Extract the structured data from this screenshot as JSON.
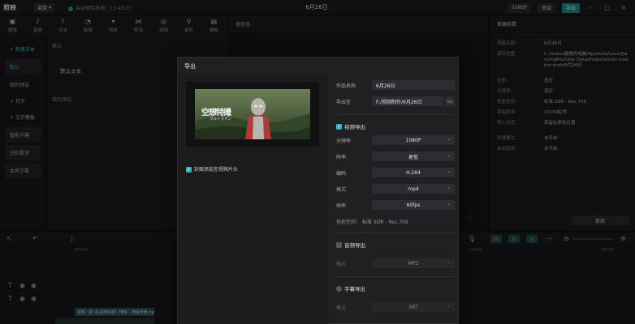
{
  "titlebar": {
    "logo": "剪映",
    "menu": "菜单",
    "autosave": "自动保存本地：12:43:07",
    "title": "6月26日",
    "mode_chip": "1080P",
    "review": "审阅",
    "export": "导出"
  },
  "tabs": [
    {
      "label": "媒体",
      "icon": "media-icon"
    },
    {
      "label": "音频",
      "icon": "audio-icon"
    },
    {
      "label": "文本",
      "icon": "text-icon",
      "active": true
    },
    {
      "label": "贴纸",
      "icon": "sticker-icon"
    },
    {
      "label": "特效",
      "icon": "effects-icon"
    },
    {
      "label": "转场",
      "icon": "transition-icon"
    },
    {
      "label": "滤镜",
      "icon": "filter-icon"
    },
    {
      "label": "调节",
      "icon": "adjust-icon"
    },
    {
      "label": "模板",
      "icon": "template-icon"
    }
  ],
  "sidebar": {
    "items": [
      {
        "label": "+ 新建文本",
        "active": true,
        "sub": false
      },
      {
        "label": "默认",
        "active": true,
        "sub": true
      },
      {
        "label": "我的预设",
        "active": false,
        "sub": false
      },
      {
        "label": "+ 花字",
        "active": false,
        "sub": false
      },
      {
        "label": "+ 文字模板",
        "active": false,
        "sub": false
      },
      {
        "label": "智能字幕",
        "active": false,
        "sub": true
      },
      {
        "label": "识别歌词",
        "active": false,
        "sub": true
      },
      {
        "label": "本地字幕",
        "active": false,
        "sub": true
      }
    ]
  },
  "content": {
    "section1": "默认",
    "default_text": "默认文本",
    "section2": "我的预设"
  },
  "player": {
    "title": "播放器"
  },
  "right_panel": {
    "title": "草稿参数",
    "rows": [
      {
        "key": "草稿名称：",
        "value": "6月26日"
      },
      {
        "key": "保存位置：",
        "value": "C:/Users/晨旗的电脑/AppData/Local/JianyingPro/User Data/Projects/com.lveditor.draft/6月26日"
      },
      {
        "key": "比例：",
        "value": "适应"
      },
      {
        "key": "分辨率：",
        "value": "适应"
      },
      {
        "key": "色彩空间：",
        "value": "标准 SDR - Rec.709"
      },
      {
        "key": "草稿帧率：",
        "value": "30.00帧/秒"
      },
      {
        "key": "导入方式：",
        "value": "保留在原有位置"
      },
      {
        "key": "代理模式：",
        "value": "未开启"
      },
      {
        "key": "自由层级：",
        "value": "未开启"
      }
    ],
    "edit": "修改"
  },
  "timeline": {
    "ruler": [
      "|00:00",
      "|00:30",
      "|00:00"
    ],
    "clip_label": "视频《初 高清奥特曼》特辑 - 神秘怪兽.mp4"
  },
  "modal": {
    "title": "导出",
    "thumb_title": "空想特撮",
    "thumb_sub": "ウルトラマン",
    "cover_check": "封面添加至视频片头",
    "name_label": "作品名称",
    "name_value": "6月26日",
    "path_label": "导出至",
    "path_value": "F:/视频制作/6月26日",
    "video_section": "视频导出",
    "video_fields": [
      {
        "label": "分辨率",
        "value": "1080P"
      },
      {
        "label": "码率",
        "value": "更低"
      },
      {
        "label": "编码",
        "value": "H.264"
      },
      {
        "label": "格式",
        "value": "mp4"
      },
      {
        "label": "帧率",
        "value": "60fps"
      }
    ],
    "color_space": "色彩空间：  标准 SDR - Rec.709",
    "audio_section": "音频导出",
    "audio_format_label": "格式",
    "audio_format_value": "MP3",
    "subtitle_section": "字幕导出",
    "subtitle_format_label": "格式",
    "subtitle_format_value": "SRT"
  },
  "colors": {
    "accent": "#2fc5c0",
    "checkbox": "#2fb4c4",
    "export_button": "#1a8f8c"
  }
}
